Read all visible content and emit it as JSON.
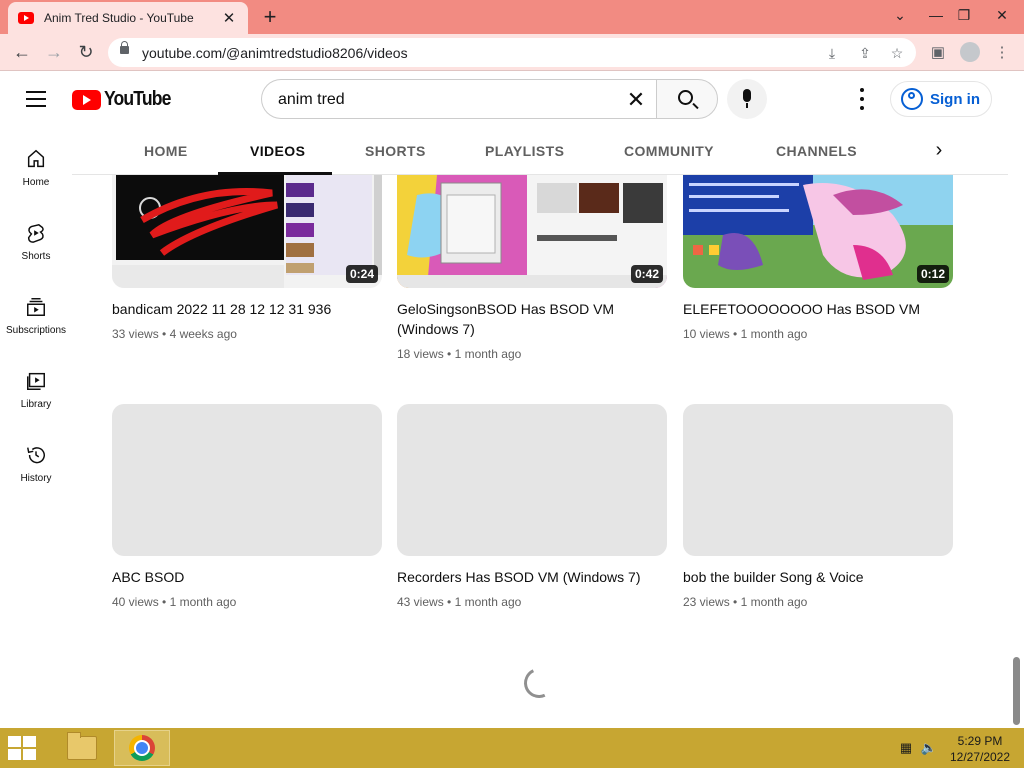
{
  "browser": {
    "tab_title": "Anim Tred Studio - YouTube",
    "url": "youtube.com/@animtredstudio8206/videos"
  },
  "masthead": {
    "logo_text": "YouTube",
    "search_value": "anim tred",
    "signin_label": "Sign in"
  },
  "guide": {
    "items": [
      {
        "label": "Home",
        "icon": "home-icon"
      },
      {
        "label": "Shorts",
        "icon": "shorts-icon"
      },
      {
        "label": "Subscriptions",
        "icon": "subscriptions-icon"
      },
      {
        "label": "Library",
        "icon": "library-icon"
      },
      {
        "label": "History",
        "icon": "history-icon"
      }
    ]
  },
  "channel_tabs": {
    "items": [
      "HOME",
      "VIDEOS",
      "SHORTS",
      "PLAYLISTS",
      "COMMUNITY",
      "CHANNELS"
    ],
    "active": "VIDEOS"
  },
  "videos": [
    {
      "title": "bandicam 2022 11 28 12 12 31 936",
      "views": "33 views",
      "age": "4 weeks ago",
      "duration": "0:24"
    },
    {
      "title": "GeloSingsonBSOD Has BSOD VM (Windows 7)",
      "views": "18 views",
      "age": "1 month ago",
      "duration": "0:42"
    },
    {
      "title": "ELEFETOOOOOOOO Has BSOD VM",
      "views": "10 views",
      "age": "1 month ago",
      "duration": "0:12"
    },
    {
      "title": "ABC BSOD",
      "views": "40 views",
      "age": "1 month ago",
      "duration": ""
    },
    {
      "title": "Recorders Has BSOD VM (Windows 7)",
      "views": "43 views",
      "age": "1 month ago",
      "duration": ""
    },
    {
      "title": "bob the builder Song & Voice",
      "views": "23 views",
      "age": "1 month ago",
      "duration": ""
    }
  ],
  "meta_separator": "•",
  "taskbar": {
    "time": "5:29 PM",
    "date": "12/27/2022"
  },
  "colors": {
    "youtube_red": "#ff0000",
    "chrome_tabstrip": "#f28b82",
    "taskbar": "#c7a632",
    "signin_blue": "#065fd4"
  }
}
